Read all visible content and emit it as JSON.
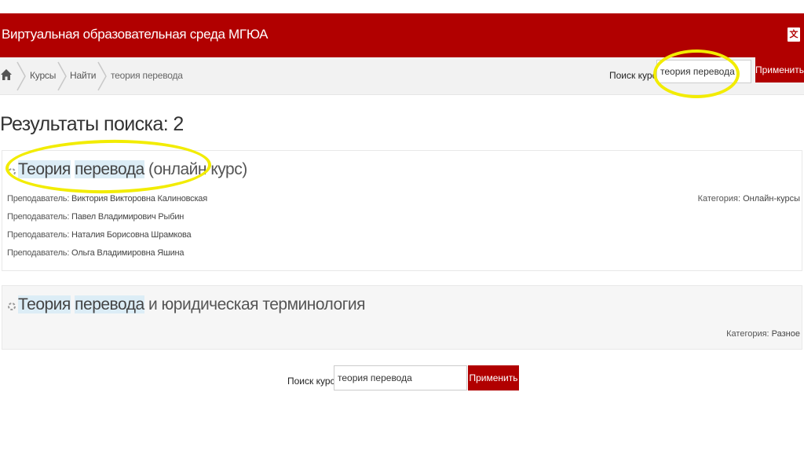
{
  "header": {
    "site_title": "Виртуальная образовательная среда МГЮА",
    "translate_icon": "translate-icon"
  },
  "breadcrumb": {
    "home_icon": "home-icon",
    "items": [
      "Курсы",
      "Найти",
      "теория перевода"
    ]
  },
  "top_search": {
    "label": "Поиск курса:",
    "value": "теория перевода",
    "button_label": "Применить"
  },
  "results": {
    "heading": "Результаты поиска: 2",
    "courses": [
      {
        "title_hl1": "Теория",
        "title_hl2": "перевода",
        "title_rest": "(онлайн курс)",
        "teachers": [
          {
            "label": "Преподаватель:",
            "name": "Виктория Викторовна Калиновская"
          },
          {
            "label": "Преподаватель:",
            "name": "Павел Владимирович Рыбин"
          },
          {
            "label": "Преподаватель:",
            "name": "Наталия Борисовна Шрамкова"
          },
          {
            "label": "Преподаватель:",
            "name": "Ольга Владимировна Яшина"
          }
        ],
        "category_label": "Категория:",
        "category_value": "Онлайн-курсы"
      },
      {
        "title_hl1": "Теория",
        "title_hl2": "перевода",
        "title_rest": "и юридическая терминология",
        "category_label": "Категория:",
        "category_value": "Разное"
      }
    ]
  },
  "bottom_search": {
    "label": "Поиск курса:",
    "value": "теория перевода",
    "button_label": "Применить"
  },
  "colors": {
    "brand": "#b10000",
    "highlight": "#dcedf6",
    "annotation": "#f2ec00"
  }
}
